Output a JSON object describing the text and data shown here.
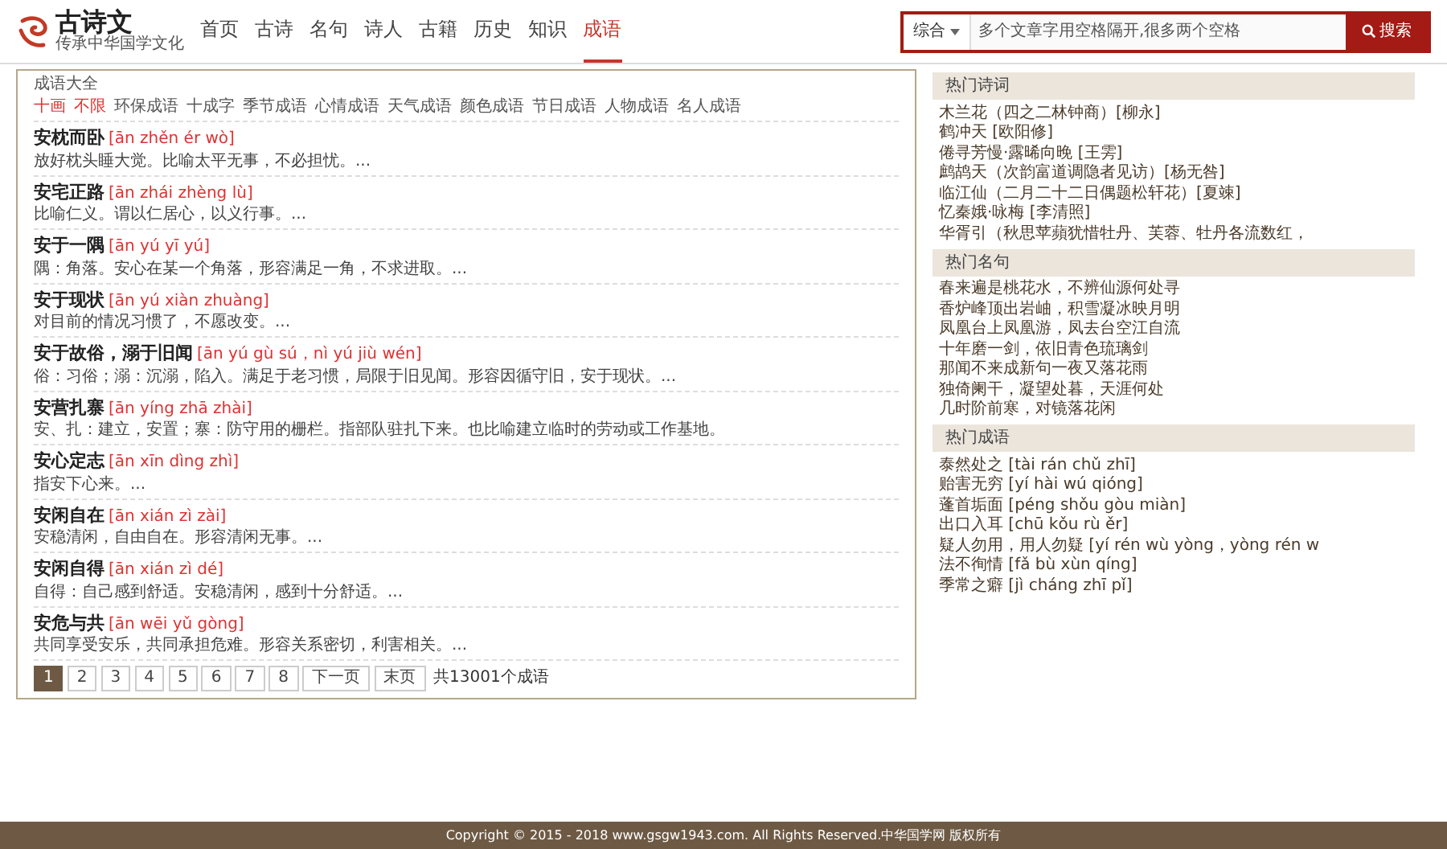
{
  "logo": {
    "title": "古诗文",
    "subtitle": "传承中华国学文化"
  },
  "nav": [
    {
      "label": "首页",
      "selected": false
    },
    {
      "label": "古诗",
      "selected": false
    },
    {
      "label": "名句",
      "selected": false
    },
    {
      "label": "诗人",
      "selected": false
    },
    {
      "label": "古籍",
      "selected": false
    },
    {
      "label": "历史",
      "selected": false
    },
    {
      "label": "知识",
      "selected": false
    },
    {
      "label": "成语",
      "selected": true
    }
  ],
  "search": {
    "scope": "综合",
    "value": "多个文章字用空格隔开,很多两个空格",
    "button": "搜索"
  },
  "section_title": "成语大全",
  "filters": [
    {
      "label": "十画",
      "selected": true
    },
    {
      "label": "不限",
      "selected": true
    },
    {
      "label": "环保成语",
      "selected": false
    },
    {
      "label": "十成字",
      "selected": false
    },
    {
      "label": "季节成语",
      "selected": false
    },
    {
      "label": "心情成语",
      "selected": false
    },
    {
      "label": "天气成语",
      "selected": false
    },
    {
      "label": "颜色成语",
      "selected": false
    },
    {
      "label": "节日成语",
      "selected": false
    },
    {
      "label": "人物成语",
      "selected": false
    },
    {
      "label": "名人成语",
      "selected": false
    }
  ],
  "idioms": [
    {
      "word": "安枕而卧",
      "pinyin": "[ān zhěn ér wò]",
      "meaning": "放好枕头睡大觉。比喻太平无事，不必担忧。..."
    },
    {
      "word": "安宅正路",
      "pinyin": "[ān zhái zhèng lù]",
      "meaning": "比喻仁义。谓以仁居心，以义行事。..."
    },
    {
      "word": "安于一隅",
      "pinyin": "[ān yú yī yú]",
      "meaning": "隅：角落。安心在某一个角落，形容满足一角，不求进取。..."
    },
    {
      "word": "安于现状",
      "pinyin": "[ān yú xiàn zhuàng]",
      "meaning": "对目前的情况习惯了，不愿改变。..."
    },
    {
      "word": "安于故俗，溺于旧闻",
      "pinyin": "[ān yú gù sú，nì yú jiù wén]",
      "meaning": "俗：习俗；溺：沉溺，陷入。满足于老习惯，局限于旧见闻。形容因循守旧，安于现状。..."
    },
    {
      "word": "安营扎寨",
      "pinyin": "[ān yíng zhā zhài]",
      "meaning": "安、扎：建立，安置；寨：防守用的栅栏。指部队驻扎下来。也比喻建立临时的劳动或工作基地。"
    },
    {
      "word": "安心定志",
      "pinyin": "[ān xīn dìng zhì]",
      "meaning": "指安下心来。..."
    },
    {
      "word": "安闲自在",
      "pinyin": "[ān xián zì zài]",
      "meaning": "安稳清闲，自由自在。形容清闲无事。..."
    },
    {
      "word": "安闲自得",
      "pinyin": "[ān xián zì dé]",
      "meaning": "自得：自己感到舒适。安稳清闲，感到十分舒适。..."
    },
    {
      "word": "安危与共",
      "pinyin": "[ān wēi yǔ gòng]",
      "meaning": "共同享受安乐，共同承担危难。形容关系密切，利害相关。..."
    }
  ],
  "pagination": {
    "pages": [
      {
        "label": "1",
        "selected": true
      },
      {
        "label": "2",
        "selected": false
      },
      {
        "label": "3",
        "selected": false
      },
      {
        "label": "4",
        "selected": false
      },
      {
        "label": "5",
        "selected": false
      },
      {
        "label": "6",
        "selected": false
      },
      {
        "label": "7",
        "selected": false
      },
      {
        "label": "8",
        "selected": false
      }
    ],
    "next": "下一页",
    "last": "末页",
    "total": "共13001个成语"
  },
  "sidebar": [
    {
      "title": "热门诗词",
      "items": [
        "木兰花（四之二林钟商）[柳永]",
        "鹤冲天 [欧阳修]",
        "倦寻芳慢·露晞向晚 [王雱]",
        "鹧鸪天（次韵富道调隐者见访）[杨无咎]",
        "临江仙（二月二十二日偶题松轩花）[夏竦]",
        "忆秦娥·咏梅 [李清照]",
        "华胥引（秋思苹蘋犹惜牡丹、芙蓉、牡丹各流数红，"
      ]
    },
    {
      "title": "热门名句",
      "items": [
        "春来遍是桃花水，不辨仙源何处寻",
        "香炉峰顶出岩岫，积雪凝冰映月明",
        "凤凰台上凤凰游，凤去台空江自流",
        "十年磨一剑，依旧青色琉璃剑",
        "那闻不来成新句一夜又落花雨",
        "独倚阑干，凝望处暮，天涯何处",
        "几时阶前寒，对镜落花闲"
      ]
    },
    {
      "title": "热门成语",
      "items": [
        "泰然处之 [tài rán chǔ zhī]",
        "贻害无穷 [yí hài wú qióng]",
        "蓬首垢面 [péng shǒu gòu miàn]",
        "出口入耳 [chū kǒu rù ěr]",
        "疑人勿用，用人勿疑 [yí rén wù yòng，yòng rén w",
        "法不徇情 [fǎ bù xùn qíng]",
        "季常之癖 [jì cháng zhī pǐ]"
      ]
    }
  ],
  "footer": "Copyright © 2015 - 2018 www.gsgw1943.com. All Rights Reserved.中华国学网 版权所有"
}
